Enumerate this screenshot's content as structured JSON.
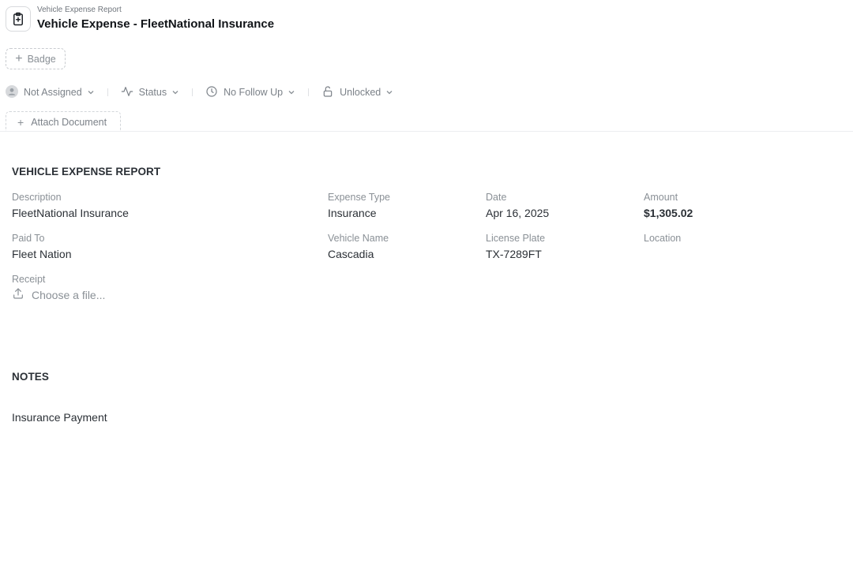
{
  "header": {
    "subtitle": "Vehicle Expense Report",
    "title": "Vehicle Expense - FleetNational Insurance"
  },
  "badge_button": {
    "label": "Badge"
  },
  "toolbar": {
    "assignee": "Not Assigned",
    "status": "Status",
    "follow_up": "No Follow Up",
    "lock": "Unlocked"
  },
  "tabs": {
    "attach": "Attach Document"
  },
  "report": {
    "section_title": "VEHICLE EXPENSE REPORT",
    "description": {
      "label": "Description",
      "value": "FleetNational Insurance"
    },
    "expense_type": {
      "label": "Expense Type",
      "value": "Insurance"
    },
    "date": {
      "label": "Date",
      "value": "Apr 16, 2025"
    },
    "amount": {
      "label": "Amount",
      "value": "$1,305.02"
    },
    "paid_to": {
      "label": "Paid To",
      "value": "Fleet Nation"
    },
    "vehicle_name": {
      "label": "Vehicle Name",
      "value": "Cascadia"
    },
    "license_plate": {
      "label": "License Plate",
      "value": "TX-7289FT"
    },
    "location": {
      "label": "Location",
      "value": ""
    },
    "receipt": {
      "label": "Receipt",
      "placeholder": "Choose a file..."
    }
  },
  "notes": {
    "section_title": "NOTES",
    "text": "Insurance Payment"
  },
  "icons": {
    "app": "clipboard-plus-icon",
    "assignee": "user-avatar-icon",
    "status": "activity-icon",
    "follow_up": "clock-icon",
    "lock": "unlock-icon",
    "upload": "upload-icon"
  }
}
